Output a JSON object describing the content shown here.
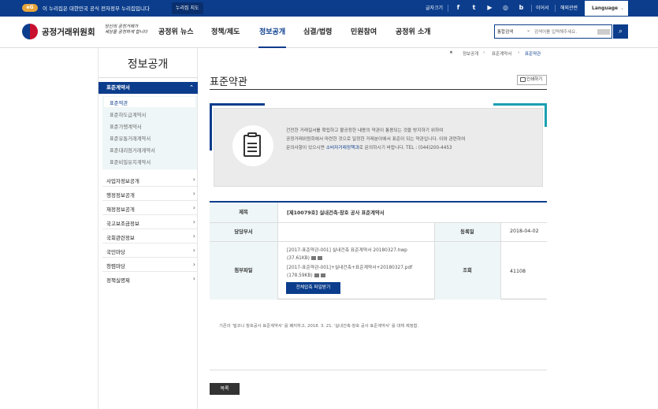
{
  "gov": {
    "emblem": "eG",
    "text": "이 누리집은 대한민국 공식 전자정부 누리집입니다",
    "sitemap_btn": "누리집 지도",
    "util_font": "글자크기",
    "util_en": "이어서",
    "util_mobile": "해외관련",
    "language": "Language"
  },
  "header": {
    "logo": "공정거래위원회",
    "slogan_1": "당신의 공정거래가",
    "slogan_2": "세상을 공정하게 합니다",
    "nav": [
      "공정위 뉴스",
      "정책/제도",
      "정보공개",
      "심결/법령",
      "민원참여",
      "공정위 소개"
    ],
    "search_select": "통합검색",
    "search_placeholder": "검색어를 입력해주세요."
  },
  "lnb": {
    "title": "정보공개",
    "active": "표준계약서",
    "sub": [
      "표준약관",
      "표준하도급계약서",
      "표준가맹계약서",
      "표준유통거래계약서",
      "표준대리점거래계약서",
      "표준비밀유지계약서"
    ],
    "items": [
      "사업자정보공개",
      "행정정보공개",
      "재정정보공개",
      "국고보조금정보",
      "국회관련정보",
      "국민마당",
      "청렴마당",
      "정책실명제"
    ]
  },
  "breadcrumb": [
    "정보공개",
    "표준계약서",
    "표준약관"
  ],
  "page": {
    "title": "표준약관",
    "print": "인쇄하기",
    "info_1": "건전한 거래질서를 확립하고 불공정한 내용의 약관이 통용되는 것을 방지하기 위하여",
    "info_2": "공정거래위원회에서 마련한 것으로 일정한 거래분야에서 표준이 되는 약관입니다. 이와 관련하여",
    "info_3a": "문의사항이 있으시면 ",
    "info_link": "소비자거래정책과",
    "info_3b": "로 문의하시기 바랍니다. TEL : (044)200-4453"
  },
  "table": {
    "subject_label": "제목",
    "subject": "[제10079호] 실내건축·창호 공사 표준계약서",
    "dept_label": "담당부서",
    "dept": "",
    "date_label": "등록일",
    "date": "2018-04-02",
    "files_label": "첨부파일",
    "file1a": "[2017-표준약관-001] 실내건축 표준계약서 20180327.hwp",
    "file1b": "(37.61KB)",
    "file2a": "[2017-표준약관-001]+실내건축+표준계약서+20180327.pdf",
    "file2b": "(178.59KB)",
    "download_all": "전체압축 파일받기",
    "views_label": "조회",
    "views": "41108"
  },
  "note": "기존의 '빌코니 창호공사 표준계약서' 를 폐지하고, 2018. 3. 21. '실내건축·창호 공사 표준계약서' 를 대체 제정함.",
  "list_btn": "목록"
}
